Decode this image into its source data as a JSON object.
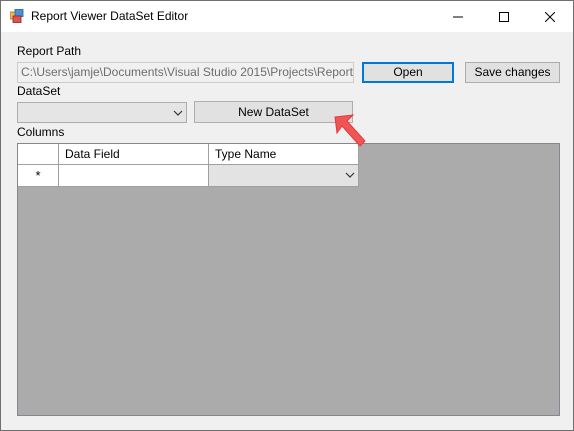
{
  "window": {
    "title": "Report Viewer DataSet Editor",
    "controls": {
      "minimize_icon": "minimize-icon",
      "maximize_icon": "maximize-icon",
      "close_icon": "close-icon"
    }
  },
  "form": {
    "report_path_label": "Report Path",
    "report_path_value": "C:\\Users\\jamje\\Documents\\Visual Studio 2015\\Projects\\ReportViewe",
    "open_button": "Open",
    "save_button": "Save changes",
    "dataset_label": "DataSet",
    "dataset_selected": "",
    "new_dataset_button": "New DataSet",
    "columns_label": "Columns"
  },
  "grid": {
    "columns": [
      "Data Field",
      "Type Name"
    ],
    "new_row_marker": "*",
    "rows": [
      {
        "data_field": "",
        "type_name": ""
      }
    ]
  },
  "colors": {
    "window_bg": "#f0f0f0",
    "grid_bg": "#ababab",
    "accent": "#0078d7",
    "annotation_arrow": "#f05454"
  }
}
